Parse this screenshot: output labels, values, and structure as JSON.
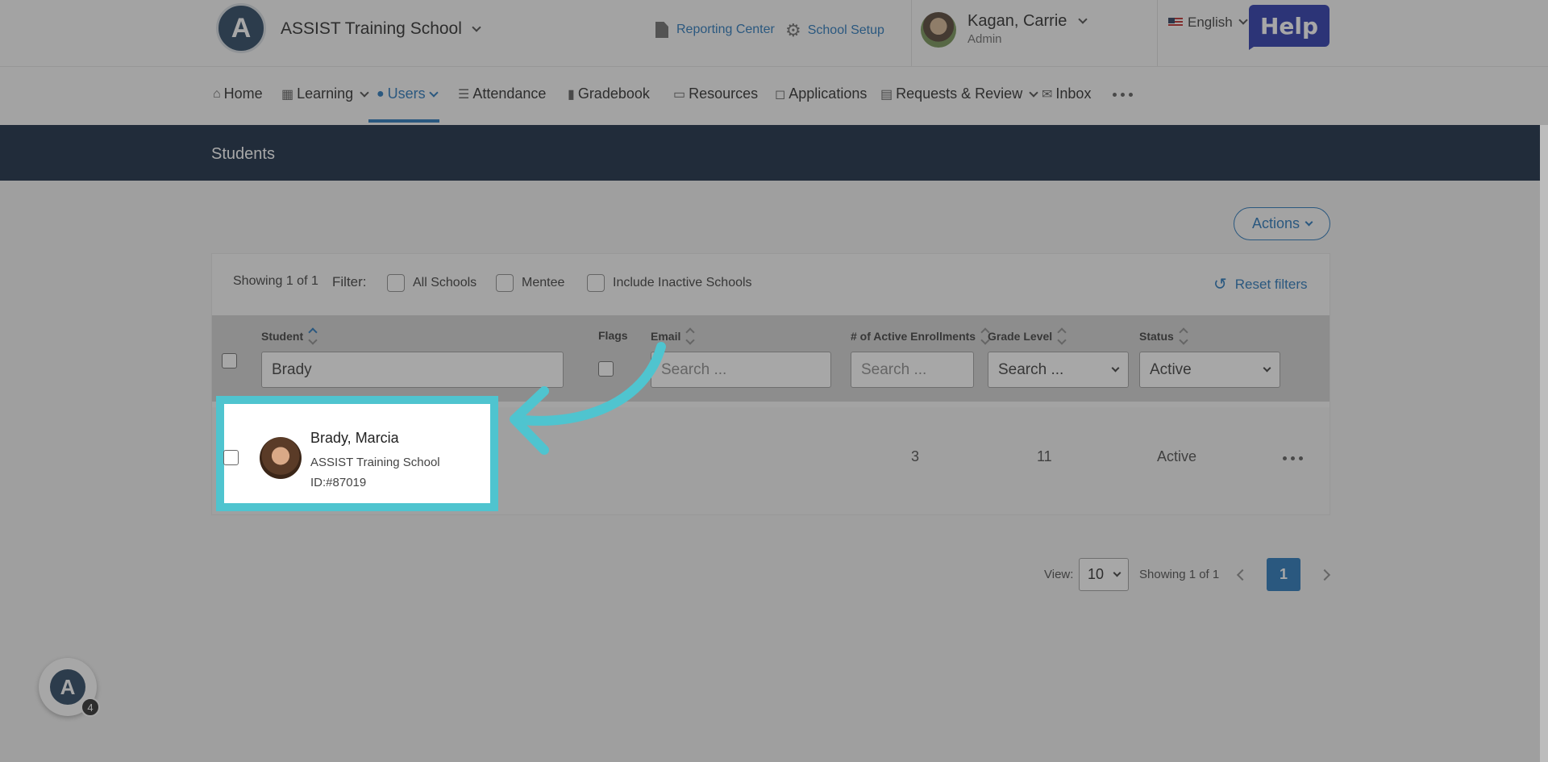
{
  "header": {
    "logo_letter": "A",
    "school_name": "ASSIST Training School",
    "reporting_center": "Reporting Center",
    "school_setup": "School Setup",
    "user_name": "Kagan, Carrie",
    "user_role": "Admin",
    "language": "English",
    "help_label": "Help"
  },
  "nav": {
    "items": [
      {
        "label": "Home",
        "icon": "home-icon"
      },
      {
        "label": "Learning",
        "icon": "grid-icon"
      },
      {
        "label": "Users",
        "icon": "user-icon",
        "active": true
      },
      {
        "label": "Attendance",
        "icon": "bars-icon"
      },
      {
        "label": "Gradebook",
        "icon": "book-icon"
      },
      {
        "label": "Resources",
        "icon": "monitor-icon"
      },
      {
        "label": "Applications",
        "icon": "chat-icon"
      },
      {
        "label": "Requests & Review",
        "icon": "clipboard-icon"
      },
      {
        "label": "Inbox",
        "icon": "mail-icon"
      }
    ]
  },
  "banner": {
    "title": "Students"
  },
  "actions_label": "Actions",
  "filters": {
    "showing": "Showing 1 of 1",
    "filter_label": "Filter:",
    "all_schools": "All Schools",
    "mentee": "Mentee",
    "include_inactive": "Include Inactive Schools",
    "reset": "Reset filters"
  },
  "table": {
    "headers": {
      "student": "Student",
      "flags": "Flags",
      "email": "Email",
      "enrollments": "# of Active Enrollments",
      "grade": "Grade Level",
      "status": "Status"
    },
    "inputs": {
      "student_value": "Brady",
      "email_placeholder": "Search ...",
      "enroll_placeholder": "Search ...",
      "grade_placeholder": "Search ...",
      "status_value": "Active"
    },
    "rows": [
      {
        "name": "Brady, Marcia",
        "school": "ASSIST Training School",
        "id": "ID:#87019",
        "enrollments": "3",
        "grade": "11",
        "status": "Active"
      }
    ]
  },
  "pager": {
    "view_label": "View:",
    "page_size": "10",
    "showing": "Showing 1 of 1",
    "current_page": "1"
  },
  "widget": {
    "logo_letter": "A",
    "badge_count": "4"
  },
  "colors": {
    "accent": "#1d6fb6",
    "banner": "#0b2039",
    "highlight": "#4fc4cf",
    "help": "#1f2fa8"
  }
}
